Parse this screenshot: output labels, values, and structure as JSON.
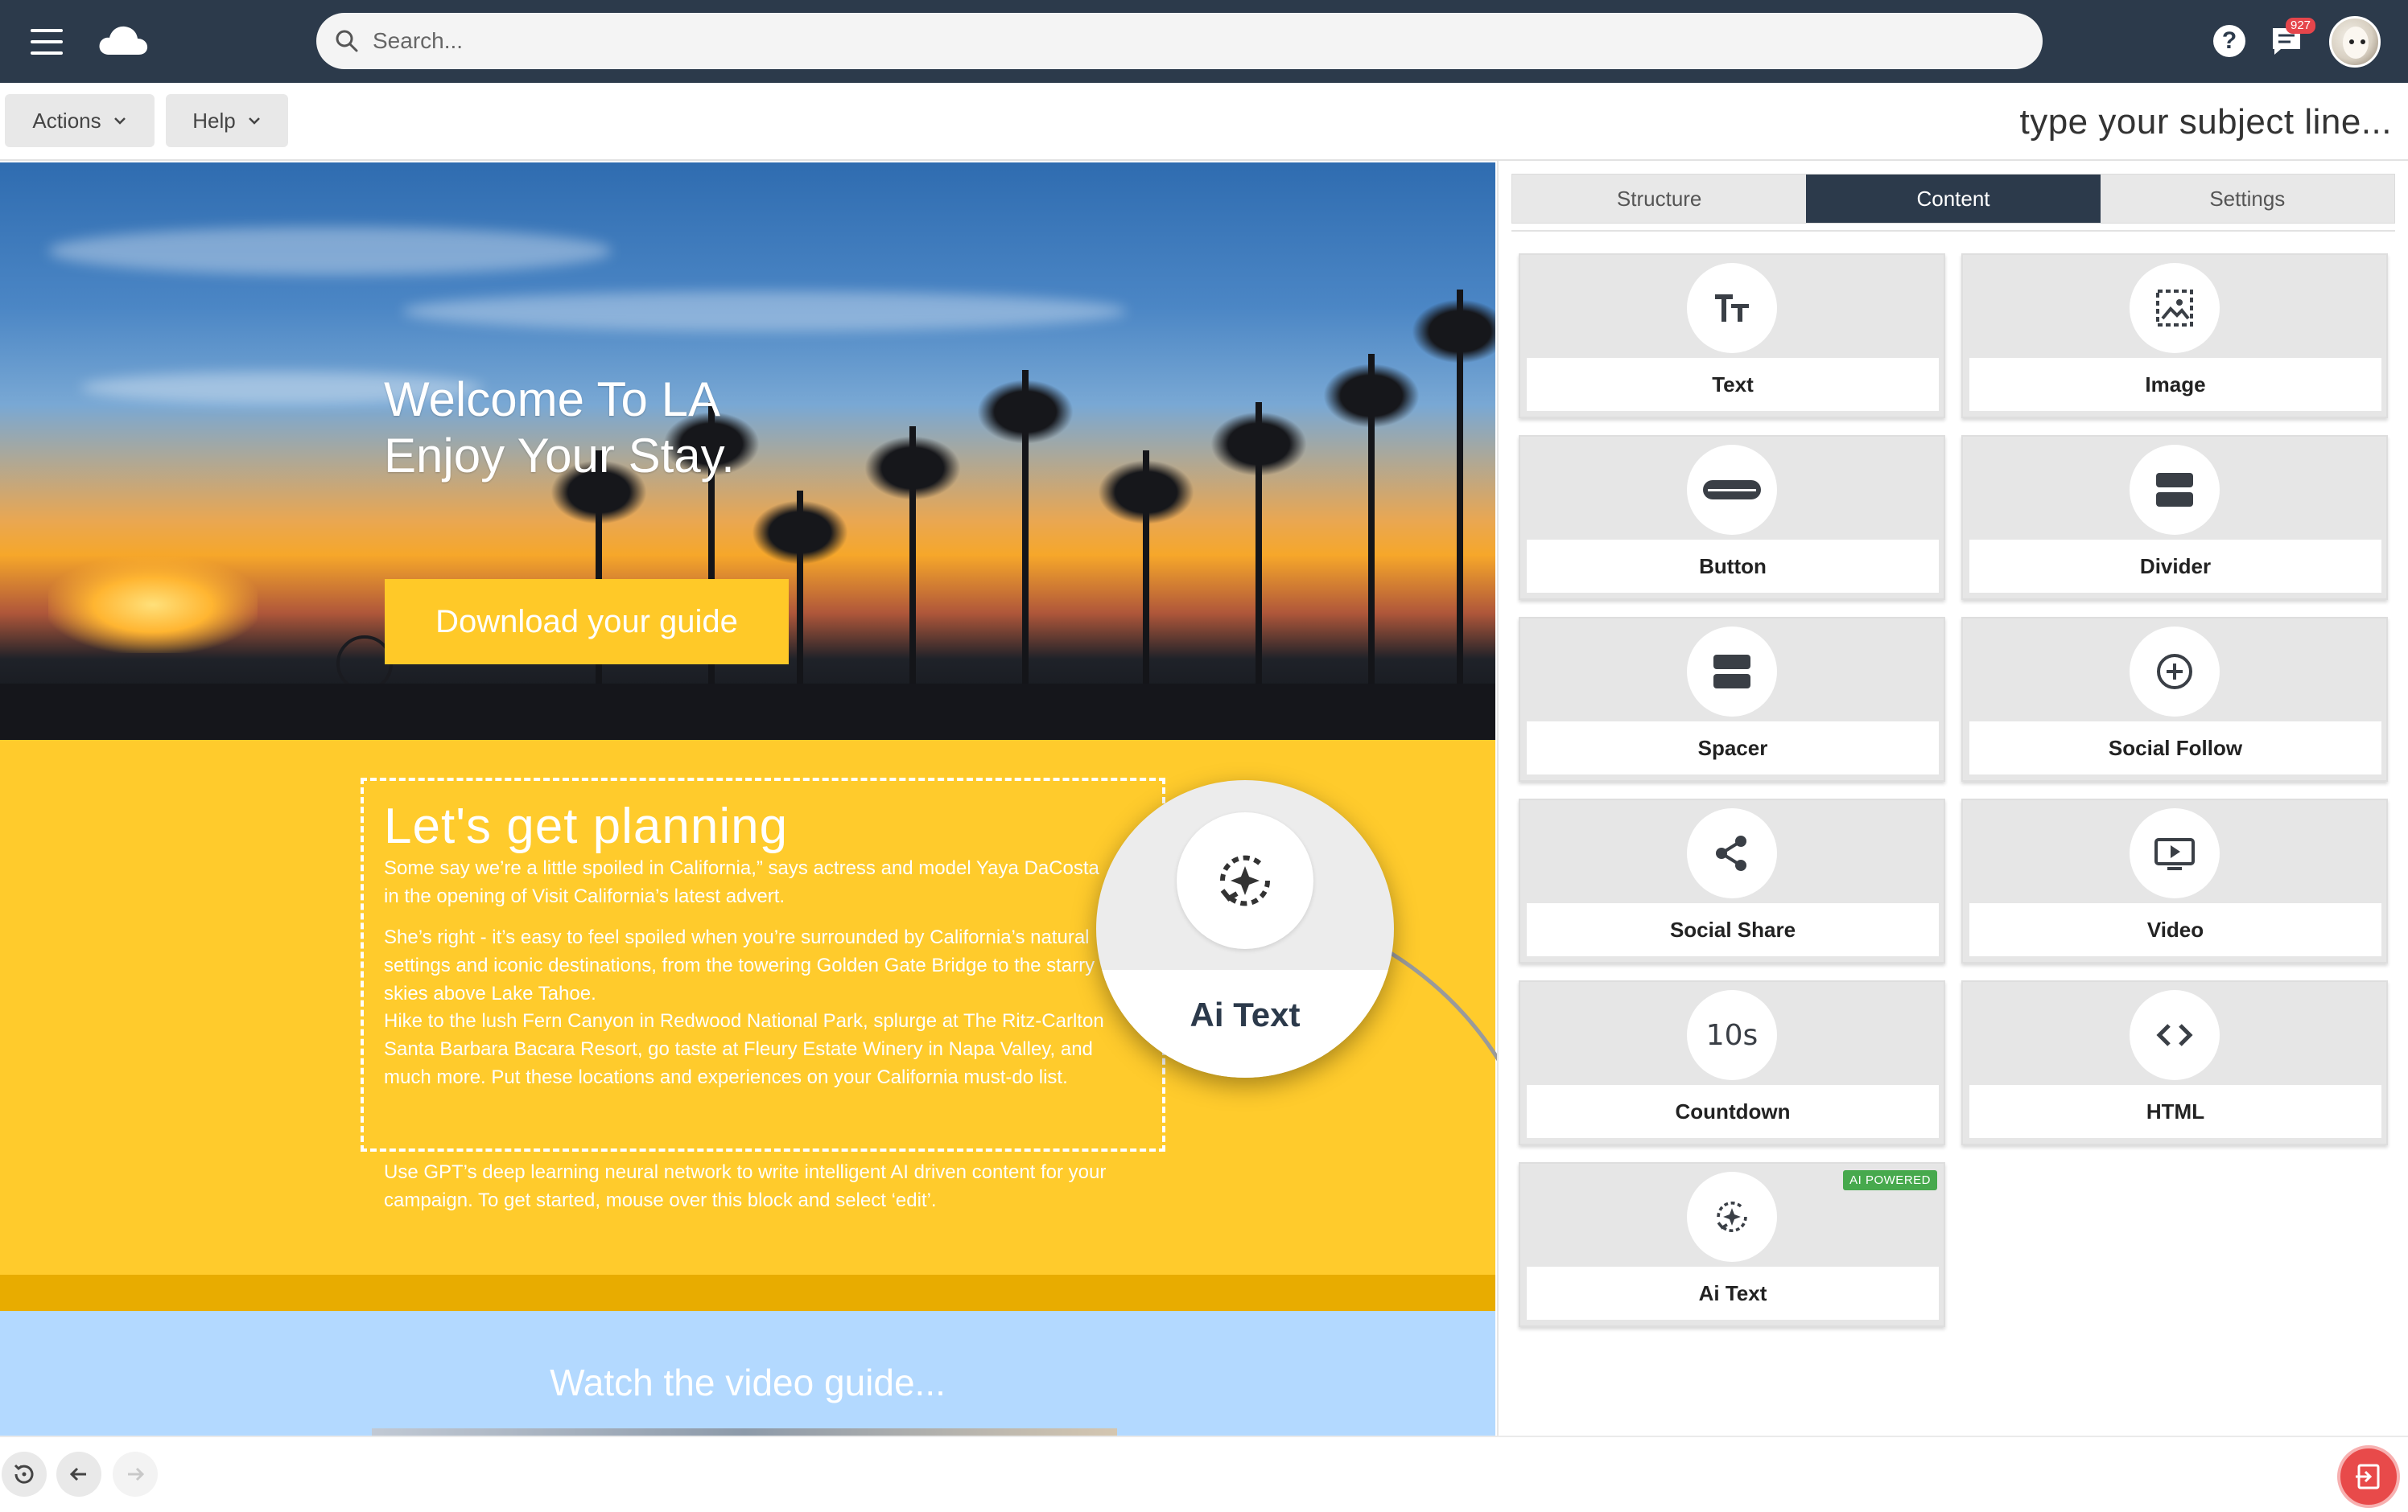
{
  "topbar": {
    "search_placeholder": "Search...",
    "notification_count": "927",
    "icons": [
      "menu-icon",
      "cloud-logo-icon",
      "search-icon",
      "help-icon",
      "chat-icon",
      "avatar"
    ]
  },
  "toolbar": {
    "actions_label": "Actions",
    "help_label": "Help",
    "subject_placeholder": "type your subject line..."
  },
  "canvas": {
    "hero": {
      "title_line1": "Welcome To LA",
      "title_line2": "Enjoy Your Stay.",
      "cta_label": "Download your guide"
    },
    "planning": {
      "title": "Let's get planning",
      "para1": "Some say we’re a little spoiled in California,” says actress and model Yaya DaCosta in the opening of Visit California’s latest advert.",
      "para2": "She’s right - it’s easy to feel spoiled when you’re surrounded by California’s natural settings and iconic destinations, from the towering Golden Gate Bridge to the starry skies above Lake Tahoe.",
      "para3": "Hike to the lush Fern Canyon in Redwood National Park, splurge at The Ritz-Carlton Santa Barbara Bacara Resort, go taste at Fleury Estate Winery in Napa Valley, and much more. Put these locations and experiences on your California must-do list.",
      "para4": "Use GPT’s deep learning neural network to write intelligent AI driven content for your campaign. To get started, mouse over this block and select ‘edit’."
    },
    "video": {
      "title": "Watch the video guide..."
    },
    "magnifier_label": "Ai Text"
  },
  "panel": {
    "tabs": [
      {
        "label": "Structure",
        "active": false
      },
      {
        "label": "Content",
        "active": true
      },
      {
        "label": "Settings",
        "active": false
      }
    ],
    "tiles": [
      {
        "label": "Text",
        "icon": "text-size-icon"
      },
      {
        "label": "Image",
        "icon": "image-icon"
      },
      {
        "label": "Button",
        "icon": "button-icon"
      },
      {
        "label": "Divider",
        "icon": "divider-icon"
      },
      {
        "label": "Spacer",
        "icon": "spacer-icon"
      },
      {
        "label": "Social Follow",
        "icon": "plus-circle-icon"
      },
      {
        "label": "Social Share",
        "icon": "share-icon"
      },
      {
        "label": "Video",
        "icon": "video-icon"
      },
      {
        "label": "Countdown",
        "icon": "countdown-icon",
        "icon_text": "10s"
      },
      {
        "label": "HTML",
        "icon": "code-icon"
      },
      {
        "label": "Ai Text",
        "icon": "ai-sparkle-icon",
        "badge": "AI POWERED"
      }
    ]
  },
  "colors": {
    "navbar": "#2c3a4b",
    "accent_yellow": "#ffcb2c",
    "active_tab": "#2c3a4b",
    "ai_badge": "#47a94d",
    "exit_button": "#e84a4a"
  }
}
